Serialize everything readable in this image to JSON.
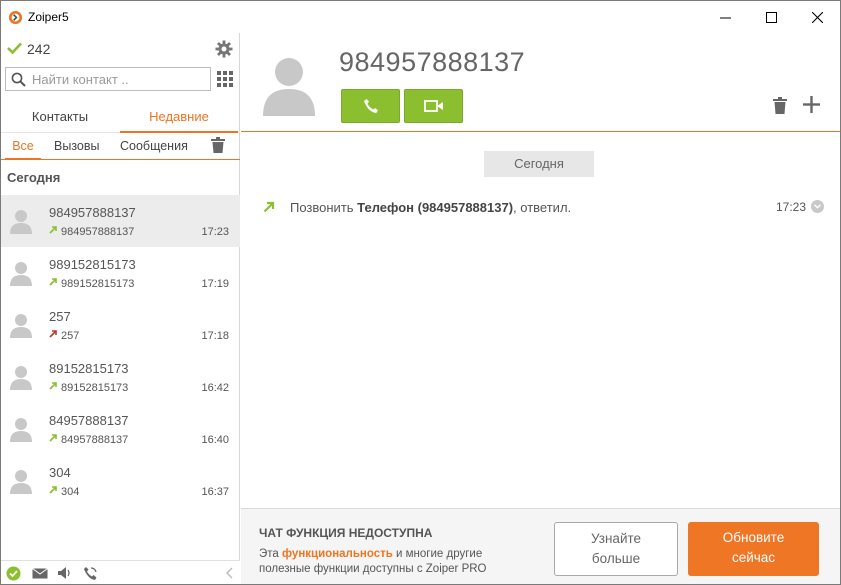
{
  "window": {
    "title": "Zoiper5"
  },
  "status": {
    "count": "242"
  },
  "search": {
    "placeholder": "Найти контакт .."
  },
  "tabs": {
    "contacts": "Контакты",
    "recent": "Недавние"
  },
  "subtabs": {
    "all": "Все",
    "calls": "Вызовы",
    "messages": "Сообщения"
  },
  "section": {
    "today": "Сегодня"
  },
  "recents": [
    {
      "name": "984957888137",
      "number": "984957888137",
      "time": "17:23",
      "direction": "outgoing"
    },
    {
      "name": "989152815173",
      "number": "989152815173",
      "time": "17:19",
      "direction": "outgoing"
    },
    {
      "name": "257",
      "number": "257",
      "time": "17:18",
      "direction": "missed"
    },
    {
      "name": "89152815173",
      "number": "89152815173",
      "time": "16:42",
      "direction": "outgoing"
    },
    {
      "name": "84957888137",
      "number": "84957888137",
      "time": "16:40",
      "direction": "outgoing"
    },
    {
      "name": "304",
      "number": "304",
      "time": "16:37",
      "direction": "outgoing"
    }
  ],
  "contact": {
    "number": "984957888137"
  },
  "history": {
    "date_label": "Сегодня",
    "prefix": "Позвонить",
    "bold": "Телефон (984957888137)",
    "suffix": ", ответил.",
    "time": "17:23"
  },
  "promo": {
    "title": "ЧАТ ФУНКЦИЯ НЕДОСТУПНА",
    "text_before": "Эта",
    "text_highlight": "функциональность",
    "text_after": "и многие другие полезные функции доступны с Zoiper PRO",
    "learn_line1": "Узнайте",
    "learn_line2": "больше",
    "upgrade_line1": "Обновите",
    "upgrade_line2": "сейчас"
  },
  "colors": {
    "accent": "#ee7421",
    "call_green": "#8cbf2f",
    "outgoing_arrow": "#8cbf2f",
    "missed_arrow": "#c0392b"
  }
}
